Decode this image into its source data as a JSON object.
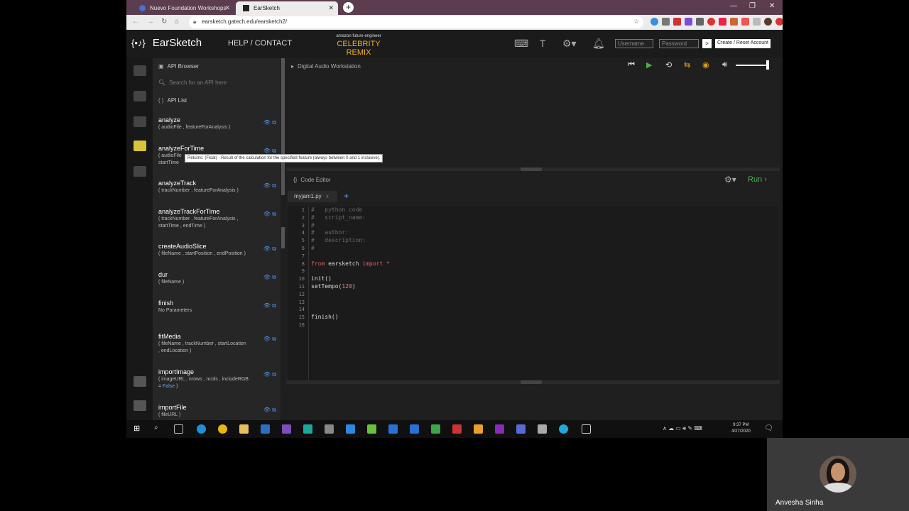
{
  "browser": {
    "tabs": [
      {
        "title": "Nuevo Foundation Workshops",
        "active": false
      },
      {
        "title": "EarSketch",
        "active": true
      }
    ],
    "url": "earsketch.gatech.edu/earsketch2/"
  },
  "header": {
    "logo_mark": "{•♪}",
    "logo_text": "EarSketch",
    "help_contact": "HELP / CONTACT",
    "amazon_line": "amazon future engineer",
    "celebrity": "CELEBRITY REMIX",
    "username_placeholder": "Username",
    "password_placeholder": "Password",
    "login_arrow": ">",
    "create_account": "Create / Reset Account"
  },
  "api_browser": {
    "title": "API Browser",
    "search_placeholder": "Search for an API here",
    "list_label": "API List",
    "items": [
      {
        "name": "analyze",
        "params": "( audioFile , featureForAnalysis )"
      },
      {
        "name": "analyzeForTime",
        "params": "( audioFile",
        "params2": "startTime"
      },
      {
        "name": "analyzeTrack",
        "params": "( trackNumber , featureForAnalysis )"
      },
      {
        "name": "analyzeTrackForTime",
        "params": "( trackNumber , featureForAnalysis ,",
        "params2": "startTime , endTime )"
      },
      {
        "name": "createAudioSlice",
        "params": "( fileName , startPosition , endPosition )"
      },
      {
        "name": "dur",
        "params": "( fileName )"
      },
      {
        "name": "finish",
        "params": "No Parameters"
      },
      {
        "name": "fitMedia",
        "params": "( fileName , trackNumber , startLocation",
        "params2": ", endLocation )"
      },
      {
        "name": "importImage",
        "params": "( imageURL , nrows , ncols , includeRGB",
        "params2_pre": "= ",
        "params2_blue": "False",
        "params2_post": " )"
      },
      {
        "name": "importFile",
        "params": "( fileURL )"
      }
    ],
    "tooltip": "Returns: (Float) - Result of the calculation for the specified feature (always between 0 and 1 inclusive)."
  },
  "daw": {
    "title": "Digital Audio Workstation"
  },
  "editor": {
    "title": "Code Editor",
    "run_label": "Run",
    "file_tab": "myjam1.py",
    "file_close": "x",
    "add_file": "+",
    "lines": [
      {
        "n": "1",
        "segments": [
          {
            "t": "#   python code",
            "c": "cm"
          }
        ]
      },
      {
        "n": "2",
        "segments": [
          {
            "t": "#   script_name:",
            "c": "cm"
          }
        ]
      },
      {
        "n": "3",
        "segments": [
          {
            "t": "#",
            "c": "cm"
          }
        ]
      },
      {
        "n": "4",
        "segments": [
          {
            "t": "#   author:",
            "c": "cm"
          }
        ]
      },
      {
        "n": "5",
        "segments": [
          {
            "t": "#   description:",
            "c": "cm"
          }
        ]
      },
      {
        "n": "6",
        "segments": [
          {
            "t": "#",
            "c": "cm"
          }
        ]
      },
      {
        "n": "7",
        "segments": []
      },
      {
        "n": "8",
        "segments": [
          {
            "t": "from",
            "c": "kw"
          },
          {
            "t": " earsketch ",
            "c": ""
          },
          {
            "t": "import",
            "c": "kw"
          },
          {
            "t": " *",
            "c": "kw"
          }
        ]
      },
      {
        "n": "9",
        "segments": []
      },
      {
        "n": "10",
        "segments": [
          {
            "t": "init()",
            "c": ""
          }
        ]
      },
      {
        "n": "11",
        "segments": [
          {
            "t": "setTempo(",
            "c": ""
          },
          {
            "t": "120",
            "c": "num"
          },
          {
            "t": ")",
            "c": ""
          }
        ]
      },
      {
        "n": "12",
        "segments": []
      },
      {
        "n": "13",
        "segments": []
      },
      {
        "n": "14",
        "segments": []
      },
      {
        "n": "15",
        "segments": [
          {
            "t": "finish()",
            "c": ""
          }
        ]
      },
      {
        "n": "16",
        "segments": []
      }
    ]
  },
  "taskbar": {
    "time": "9:37 PM",
    "date": "4/27/2020"
  },
  "webcam": {
    "name": "Anvesha Sinha"
  }
}
